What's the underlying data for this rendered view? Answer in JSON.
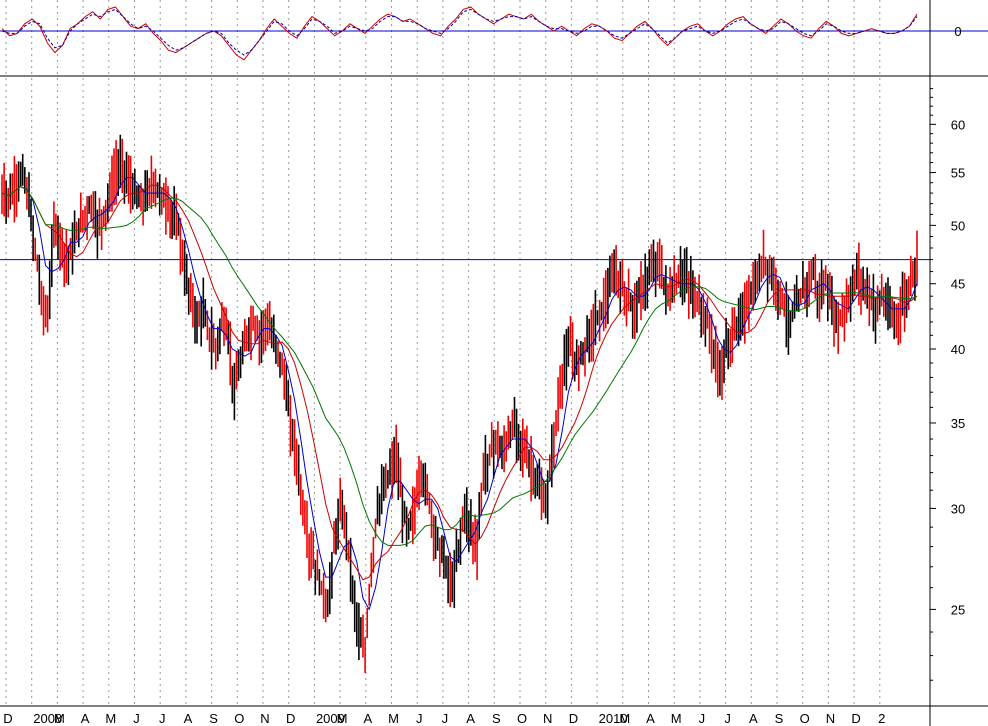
{
  "chart_data": [
    {
      "type": "line",
      "name": "oscillator",
      "ylim": [
        -1,
        1
      ],
      "y_ticks": [
        "0"
      ],
      "reference_lines": [
        0
      ],
      "series": [
        {
          "color": "#cc0000",
          "style": "solid",
          "values": [
            0.1,
            -0.2,
            -0.1,
            0.3,
            0.5,
            0.2,
            -0.5,
            -0.9,
            -0.6,
            0.1,
            0.3,
            0.6,
            0.8,
            0.5,
            0.9,
            1.0,
            0.6,
            0.2,
            0.1,
            0.3,
            -0.1,
            -0.4,
            -0.8,
            -0.9,
            -0.7,
            -0.5,
            -0.3,
            -0.1,
            0.0,
            -0.2,
            -0.6,
            -1.0,
            -1.2,
            -0.8,
            -0.4,
            0.1,
            0.5,
            0.2,
            -0.1,
            -0.3,
            0.2,
            0.6,
            0.4,
            0.1,
            -0.2,
            0.0,
            0.3,
            0.1,
            -0.1,
            0.2,
            0.5,
            0.7,
            0.6,
            0.4,
            0.5,
            0.3,
            0.1,
            -0.1,
            -0.2,
            0.2,
            0.5,
            0.9,
            1.0,
            0.7,
            0.5,
            0.3,
            0.5,
            0.7,
            0.6,
            0.5,
            0.7,
            0.4,
            0.2,
            0.0,
            0.2,
            0.0,
            -0.2,
            0.1,
            0.3,
            0.2,
            0.0,
            -0.3,
            -0.4,
            -0.1,
            0.2,
            0.4,
            0.1,
            -0.3,
            -0.6,
            -0.3,
            0.0,
            0.2,
            0.3,
            0.0,
            -0.2,
            0.0,
            0.3,
            0.5,
            0.6,
            0.3,
            0.1,
            -0.1,
            0.2,
            0.5,
            0.3,
            0.0,
            -0.2,
            -0.3,
            0.1,
            0.4,
            0.2,
            -0.1,
            -0.2,
            -0.1,
            0.0,
            0.1,
            0.0,
            -0.1,
            -0.1,
            0.0,
            0.2,
            0.7
          ]
        },
        {
          "color": "#0000aa",
          "style": "dashed",
          "values": [
            0.0,
            -0.1,
            -0.1,
            0.2,
            0.4,
            0.3,
            -0.3,
            -0.7,
            -0.6,
            0.0,
            0.3,
            0.5,
            0.7,
            0.6,
            0.8,
            0.9,
            0.6,
            0.3,
            0.1,
            0.2,
            0.0,
            -0.3,
            -0.6,
            -0.8,
            -0.7,
            -0.5,
            -0.3,
            -0.1,
            0.0,
            -0.1,
            -0.5,
            -0.8,
            -1.0,
            -0.8,
            -0.4,
            0.0,
            0.4,
            0.3,
            0.0,
            -0.2,
            0.1,
            0.5,
            0.4,
            0.2,
            -0.1,
            0.0,
            0.2,
            0.1,
            0.0,
            0.1,
            0.4,
            0.6,
            0.6,
            0.4,
            0.4,
            0.3,
            0.1,
            0.0,
            -0.1,
            0.1,
            0.4,
            0.8,
            0.9,
            0.7,
            0.5,
            0.4,
            0.5,
            0.6,
            0.6,
            0.5,
            0.6,
            0.4,
            0.2,
            0.1,
            0.1,
            0.0,
            -0.1,
            0.0,
            0.2,
            0.2,
            0.0,
            -0.2,
            -0.3,
            -0.1,
            0.1,
            0.3,
            0.1,
            -0.2,
            -0.5,
            -0.3,
            0.0,
            0.1,
            0.2,
            0.0,
            -0.1,
            0.0,
            0.2,
            0.4,
            0.5,
            0.3,
            0.1,
            0.0,
            0.1,
            0.4,
            0.3,
            0.1,
            -0.1,
            -0.2,
            0.0,
            0.3,
            0.2,
            0.0,
            -0.1,
            -0.1,
            0.0,
            0.0,
            0.0,
            -0.1,
            -0.1,
            0.0,
            0.2,
            0.6
          ]
        }
      ]
    },
    {
      "type": "line",
      "name": "price",
      "y_scale": "log",
      "ylim": [
        21,
        65
      ],
      "y_ticks": [
        25,
        30,
        35,
        40,
        45,
        50,
        55,
        60
      ],
      "reference_lines": [
        47
      ],
      "x_labels": [
        "D",
        "2008",
        "M",
        "A",
        "M",
        "J",
        "J",
        "A",
        "S",
        "O",
        "N",
        "D",
        "2009",
        "M",
        "A",
        "M",
        "J",
        "J",
        "A",
        "S",
        "O",
        "N",
        "D",
        "2010",
        "M",
        "A",
        "M",
        "J",
        "J",
        "A",
        "S",
        "O",
        "N",
        "D",
        "2"
      ],
      "closes": [
        53,
        52.5,
        54,
        55,
        52,
        48,
        44,
        42,
        50,
        49,
        47,
        48,
        50,
        51,
        52,
        50,
        51,
        53,
        55,
        56,
        54,
        53,
        52,
        53,
        54,
        53,
        52,
        51,
        50,
        46,
        44,
        42,
        43,
        41,
        40,
        42,
        41,
        37,
        39,
        41,
        42,
        41,
        42,
        41,
        40,
        38,
        35,
        33,
        30,
        28,
        27,
        26,
        25,
        28,
        30,
        29,
        26,
        24,
        23,
        27,
        30,
        31,
        32,
        33,
        30,
        29,
        30,
        32,
        31,
        29,
        28,
        27,
        26,
        28,
        30,
        29,
        28,
        32,
        33,
        34,
        33,
        34,
        35,
        34,
        33,
        32,
        31,
        30,
        33,
        36,
        39,
        40,
        39,
        40,
        41,
        42,
        43,
        44,
        46,
        45,
        44,
        43,
        44,
        45,
        46,
        47,
        45,
        44,
        45,
        46,
        45,
        44,
        43,
        42,
        40,
        38,
        40,
        41,
        42,
        43,
        44,
        45,
        47,
        46,
        45,
        44,
        42,
        43,
        44,
        45,
        46,
        44,
        45,
        43,
        42,
        43,
        44,
        46,
        45,
        44,
        43,
        44,
        43,
        42,
        43,
        44,
        46,
        47
      ],
      "moving_averages": [
        {
          "color": "#0000cc"
        },
        {
          "color": "#cc0000"
        },
        {
          "color": "#007700"
        }
      ]
    }
  ]
}
